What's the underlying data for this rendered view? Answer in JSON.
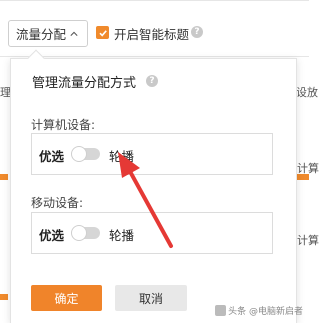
{
  "toolbar": {
    "dropdown_label": "流量分配",
    "smart_title_label": "开启智能标题",
    "smart_title_checked": true,
    "help_glyph": "?"
  },
  "background": {
    "left_text_1": "理",
    "right_text_1": "设放",
    "right_text_2": "计算",
    "right_text_3": "计算"
  },
  "popover": {
    "title": "管理流量分配方式",
    "help_glyph": "?",
    "computer_section": {
      "label": "计算机设备:",
      "option_a": "优选",
      "option_b": "轮播",
      "toggle_on": false
    },
    "mobile_section": {
      "label": "移动设备:",
      "option_a": "优选",
      "option_b": "轮播",
      "toggle_on": false
    },
    "confirm_label": "确定",
    "cancel_label": "取消"
  },
  "watermark": {
    "text": "头条 @电脑新启者"
  },
  "colors": {
    "accent": "#f08a2c",
    "annotation_arrow": "#e53935"
  }
}
